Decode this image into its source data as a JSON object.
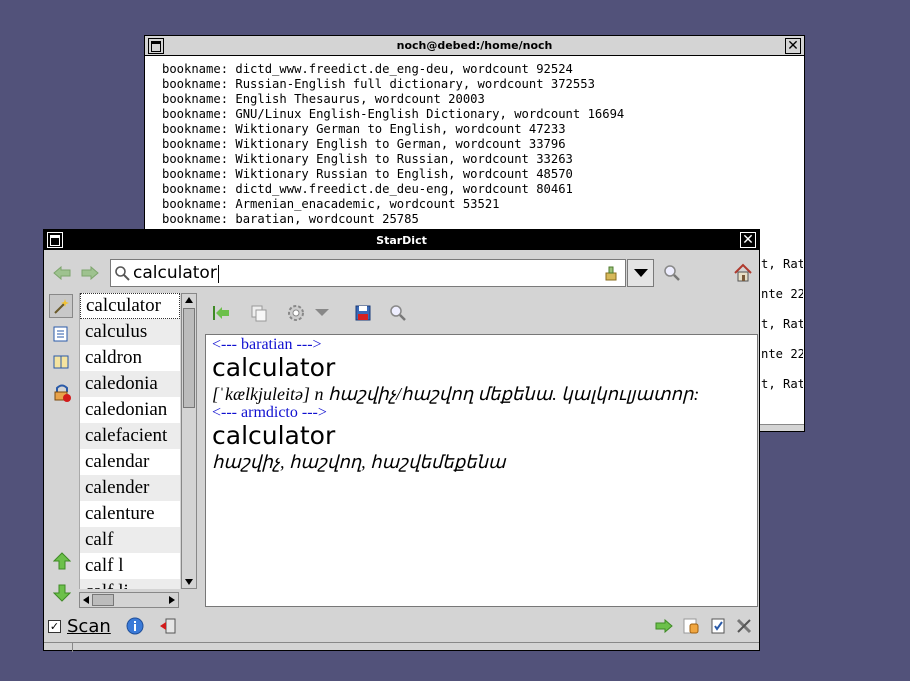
{
  "terminal": {
    "title": "noch@debed:/home/noch",
    "lines": [
      "bookname: dictd_www.freedict.de_eng-deu, wordcount 92524",
      "bookname: Russian-English full dictionary, wordcount 372553",
      "bookname: English Thesaurus, wordcount 20003",
      "bookname: GNU/Linux English-English Dictionary, wordcount 16694",
      "bookname: Wiktionary German to English, wordcount 47233",
      "bookname: Wiktionary English to German, wordcount 33796",
      "bookname: Wiktionary English to Russian, wordcount 33263",
      "bookname: Wiktionary Russian to English, wordcount 48570",
      "bookname: dictd_www.freedict.de_deu-eng, wordcount 80461",
      "bookname: Armenian_enacademic, wordcount 53521",
      "bookname: baratian, wordcount 25785"
    ],
    "fragments": [
      "t, Rat",
      "nte 22",
      "t, Rat",
      "nte 22",
      "t, Rat"
    ]
  },
  "stardict": {
    "title": "StarDict",
    "search": {
      "value": "calculator"
    },
    "icons": {
      "back": "left-arrow-icon",
      "forward": "right-arrow-icon",
      "search": "magnifier-icon",
      "clear": "clear-icon",
      "home": "home-icon"
    },
    "wordlist": [
      "calculator",
      "calculus",
      "caldron",
      "caledonia",
      "caledonian",
      "calefacient",
      "calendar",
      "calender",
      "calenture",
      "calf",
      "calf l",
      "calf li"
    ],
    "definitions": [
      {
        "dict": "<--- baratian --->",
        "word": "calculator",
        "def": "[ˈkælkjuleitə] n հաշվիչ/հաշվող մեքենա. կալկուլյատոր:"
      },
      {
        "dict": "<--- armdicto --->",
        "word": "calculator",
        "def": "հաշվիչ, հաշվող, հաշվեմեքենա"
      }
    ],
    "statusbar": {
      "scan_label": "Scan",
      "scan_checked": true
    }
  },
  "colors": {
    "desktop": "#52527a",
    "dict_header": "#1010d0",
    "window_bg": "#d4d4d4"
  }
}
